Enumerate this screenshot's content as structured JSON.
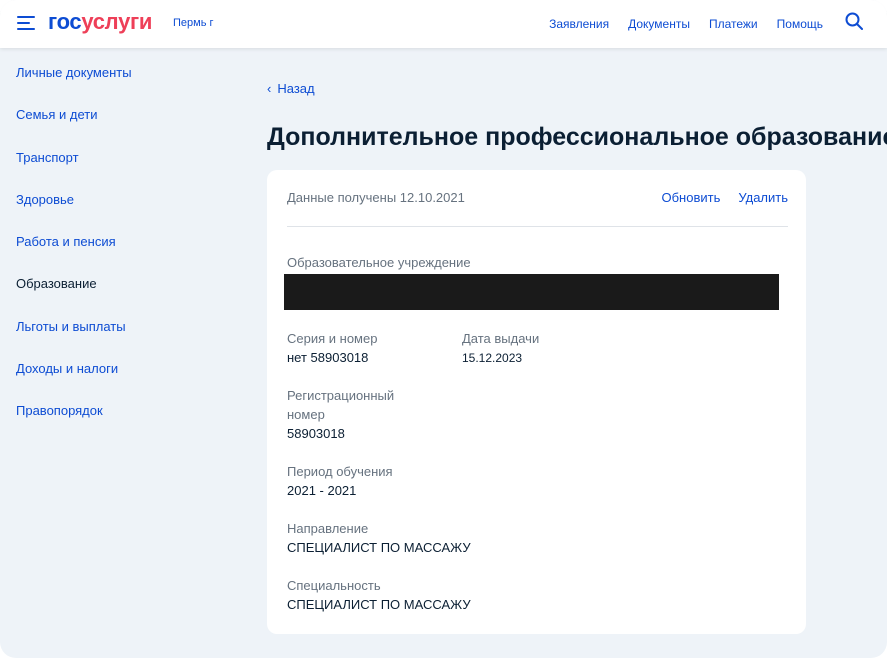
{
  "header": {
    "logo_part1": "гос",
    "logo_part2": "услуги",
    "city": "Пермь г",
    "nav": [
      "Заявления",
      "Документы",
      "Платежи",
      "Помощь"
    ],
    "brand_color": "#0d4cd3",
    "accent_color": "#ee3f58"
  },
  "sidebar": {
    "items": [
      {
        "label": "Личные документы"
      },
      {
        "label": "Семья и дети"
      },
      {
        "label": "Транспорт"
      },
      {
        "label": "Здоровье"
      },
      {
        "label": "Работа и пенсия"
      },
      {
        "label": "Образование"
      },
      {
        "label": "Льготы и выплаты"
      },
      {
        "label": "Доходы и налоги"
      },
      {
        "label": "Правопорядок"
      }
    ],
    "active": "Образование"
  },
  "main": {
    "back_label": "Назад",
    "title": "Дополнительное профессиональное образование",
    "card": {
      "received": "Данные получены 12.10.2021",
      "refresh_label": "Обновить",
      "delete_label": "Удалить",
      "institution_label": "Образовательное учреждение",
      "series_label": "Серия и номер",
      "series_value": "нет 58903018",
      "issue_date_label": "Дата выдачи",
      "issue_date_value": "15.12.2023",
      "reg_label_line1": "Регистрационный",
      "reg_label_line2": "номер",
      "reg_value": "58903018",
      "period_label": "Период обучения",
      "period_value": "2021 - 2021",
      "direction_label": "Направление",
      "direction_value": "СПЕЦИАЛИСТ ПО МАССАЖУ",
      "specialty_label": "Специальность",
      "specialty_value": "СПЕЦИАЛИСТ ПО МАССАЖУ"
    }
  }
}
